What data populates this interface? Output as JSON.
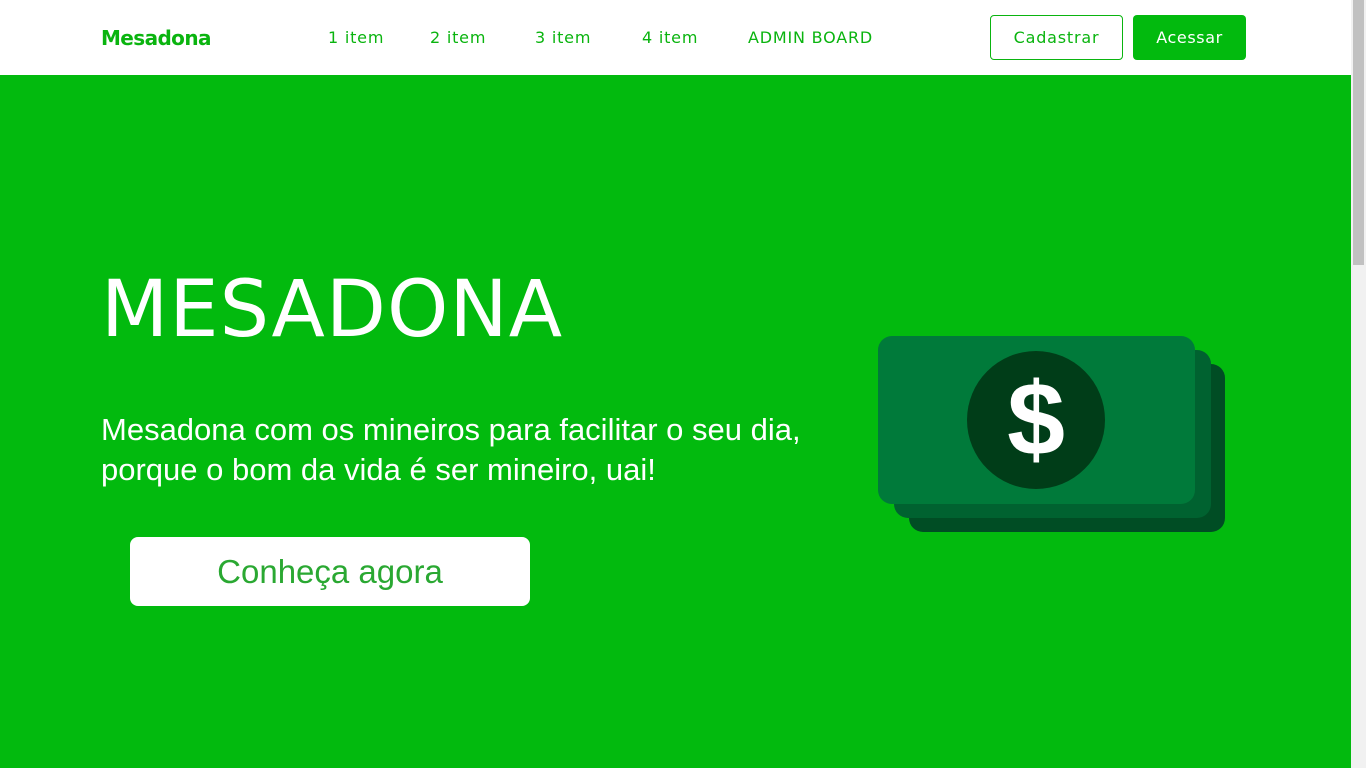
{
  "header": {
    "logo": "Mesadona",
    "nav": [
      "1 item",
      "2 item",
      "3 item",
      "4 item",
      "ADMIN BOARD"
    ],
    "register_label": "Cadastrar",
    "login_label": "Acessar"
  },
  "hero": {
    "title": "MESADONA",
    "text": "Mesadona com os mineiros para facilitar o seu dia, porque o bom da vida é ser mineiro, uai!",
    "cta_label": "Conheça agora",
    "illustration_icon": "money-bill-icon",
    "symbol": "$"
  },
  "colors": {
    "brand_green": "#02ba0e",
    "bill_front": "#007a3a",
    "bill_back": "#006230",
    "bill_shadow": "#004d24",
    "coin": "#003d18"
  }
}
